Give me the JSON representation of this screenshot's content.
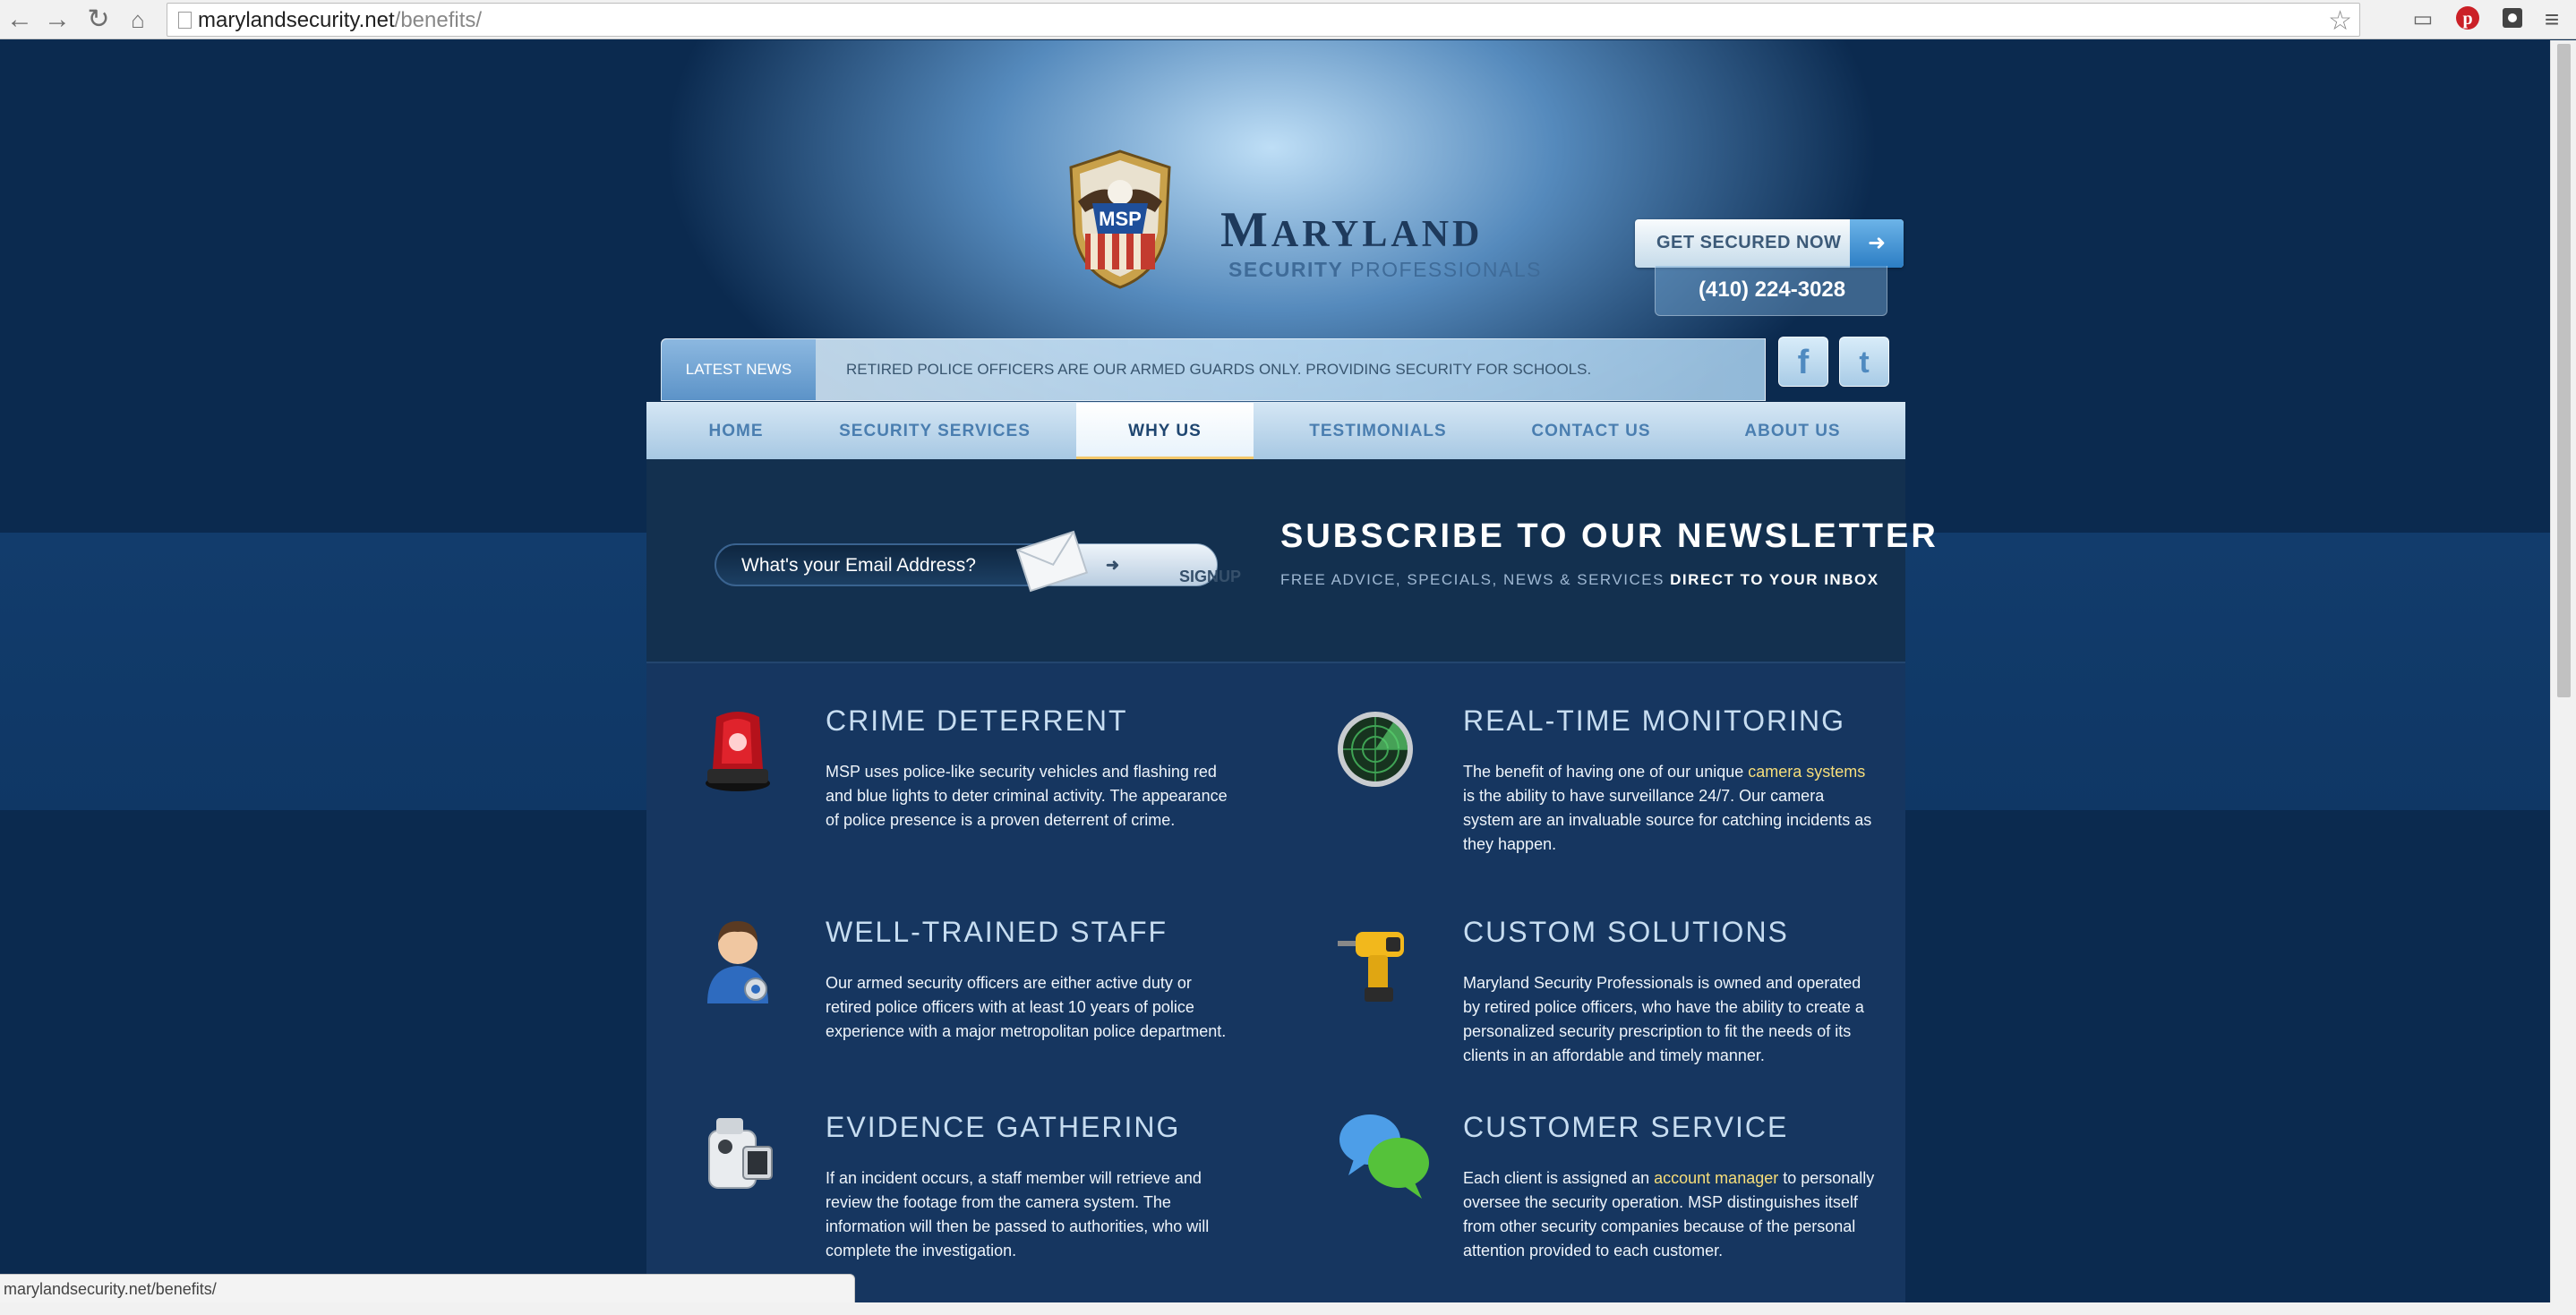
{
  "browser": {
    "url_host": "marylandsecurity.net",
    "url_path": "/benefits/",
    "status_url": "marylandsecurity.net/benefits/"
  },
  "header": {
    "badge_text": "MSP",
    "brand_first": "M",
    "brand_rest": "ARYLAND",
    "brand_sub_a": "SECURITY",
    "brand_sub_b": "PROFESSIONALS",
    "cta_label": "GET SECURED NOW",
    "phone": "(410) 224-3028"
  },
  "news": {
    "label": "LATEST NEWS",
    "text": "RETIRED POLICE OFFICERS ARE OUR ARMED GUARDS ONLY. PROVIDING SECURITY FOR SCHOOLS."
  },
  "nav": {
    "items": [
      {
        "label": "HOME"
      },
      {
        "label": "SECURITY SERVICES"
      },
      {
        "label": "WHY US"
      },
      {
        "label": "TESTIMONIALS"
      },
      {
        "label": "CONTACT US"
      },
      {
        "label": "ABOUT US"
      }
    ],
    "active": "WHY US"
  },
  "subscribe": {
    "email_placeholder": "What's your Email Address?",
    "signup_label": "SIGNUP",
    "title": "SUBSCRIBE TO OUR NEWSLETTER",
    "line_a": "FREE ADVICE, SPECIALS, NEWS & SERVICES",
    "line_b": "DIRECT TO YOUR INBOX"
  },
  "features": {
    "crime": {
      "title": "CRIME DETERRENT",
      "icon": "siren-icon",
      "text": "MSP uses police-like security vehicles and flashing red and blue lights to deter criminal activity. The appearance of police presence is a proven deterrent of crime."
    },
    "monitoring": {
      "title": "REAL-TIME MONITORING",
      "icon": "radar-icon",
      "text_a": "The benefit of having one of our unique ",
      "link": "camera systems",
      "text_b": " is the ability to have surveillance 24/7. Our camera system are an invaluable source for catching incidents as they happen."
    },
    "staff": {
      "title": "WELL-TRAINED STAFF",
      "icon": "officer-icon",
      "text": "Our armed security officers are either active duty or retired police officers with at least 10 years of police experience with a major metropolitan police department."
    },
    "custom": {
      "title": "CUSTOM SOLUTIONS",
      "icon": "drill-icon",
      "text": "Maryland Security Professionals is owned and operated by retired police officers, who have the ability to create a personalized security prescription to fit the needs of its clients in an affordable and timely manner."
    },
    "evidence": {
      "title": "EVIDENCE GATHERING",
      "icon": "camcorder-icon",
      "text": "If an incident occurs, a staff member will retrieve and review the footage from the camera system. The information will then be passed to authorities, who will complete the investigation."
    },
    "service": {
      "title": "CUSTOMER SERVICE",
      "icon": "chat-bubbles-icon",
      "text_a": "Each client is assigned an ",
      "link": "account manager",
      "text_b": " to personally oversee the security operation. MSP distinguishes itself from other security companies because of the personal attention provided to each customer."
    }
  },
  "colors": {
    "background": "#0c2d52",
    "panel": "#163660",
    "accent_gold": "#f7de7a",
    "nav_active_border": "#f2c86b"
  }
}
